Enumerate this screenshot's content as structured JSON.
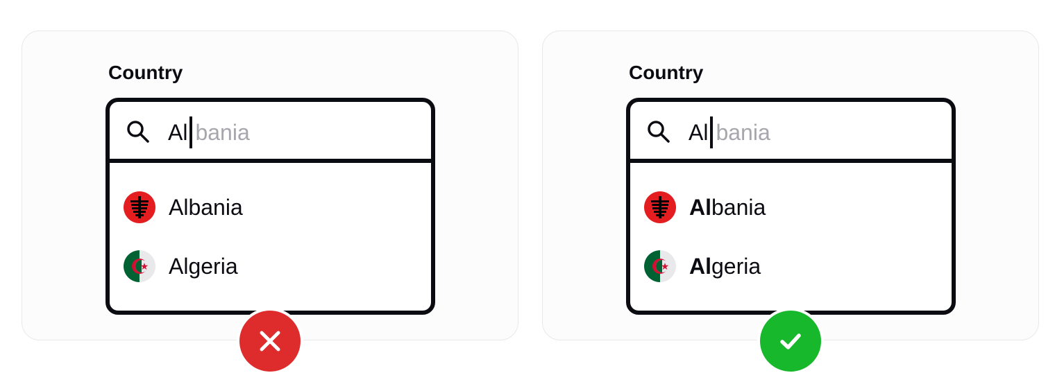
{
  "colors": {
    "ink": "#0b0b12",
    "suggestion_text": "#a6a6ad",
    "wrong": "#de2b2b",
    "correct": "#17b82b",
    "albania_flag": "#e41e20",
    "algeria_green": "#006233",
    "algeria_red": "#d21034"
  },
  "examples": [
    {
      "field_label": "Country",
      "search": {
        "typed": "Al",
        "suggestion": "bania",
        "icon": "search-icon"
      },
      "options": [
        {
          "label": "Albania",
          "icon": "albania-flag-icon"
        },
        {
          "label": "Algeria",
          "icon": "algeria-flag-icon"
        }
      ],
      "verdict_icon": "cross-icon"
    },
    {
      "field_label": "Country",
      "search": {
        "typed": "Al",
        "suggestion": "bania",
        "icon": "search-icon"
      },
      "options": [
        {
          "match": "Al",
          "rest": "bania",
          "icon": "albania-flag-icon"
        },
        {
          "match": "Al",
          "rest": "geria",
          "icon": "algeria-flag-icon"
        }
      ],
      "verdict_icon": "checkmark-icon"
    }
  ]
}
